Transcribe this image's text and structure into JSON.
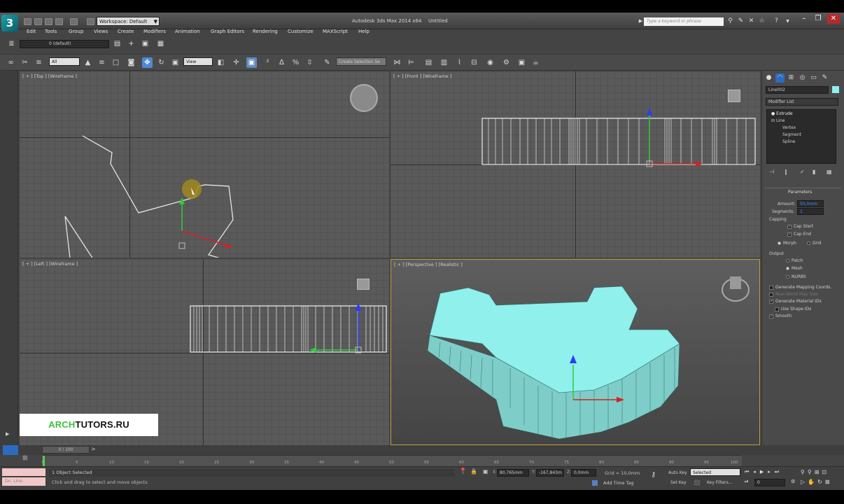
{
  "titlebar": {
    "workspace": "Workspace: Default",
    "app_title": "Autodesk 3ds Max 2014 x64",
    "doc_title": "Untitled",
    "search_placeholder": "Type a keyword or phrase"
  },
  "menu": [
    "Edit",
    "Tools",
    "Group",
    "Views",
    "Create",
    "Modifiers",
    "Animation",
    "Graph Editors",
    "Rendering",
    "Customize",
    "MAXScript",
    "Help"
  ],
  "layer_field": "0 (default)",
  "toolbar": {
    "selection_filter": "All",
    "ref_coord": "View",
    "named_selection": "Create Selection Se"
  },
  "viewports": {
    "top": "[ + ] [Top ] [Wireframe ]",
    "front": "[ + ] [Front ] [Wireframe ]",
    "left": "[ + ] [Left ] [Wireframe ]",
    "perspective": "[ + ] [Perspective ] [Realistic ]"
  },
  "command_panel": {
    "object_name": "Line002",
    "modifier_list": "Modifier List",
    "stack": [
      "Extrude",
      "Line",
      "Vertex",
      "Segment",
      "Spline"
    ],
    "rollout_title": "Parameters",
    "amount_label": "Amount:",
    "amount_value": "50,0mm",
    "segments_label": "Segments:",
    "segments_value": "1",
    "capping_label": "Capping",
    "cap_start": "Cap Start",
    "cap_end": "Cap End",
    "morph": "Morph",
    "grid": "Grid",
    "output_label": "Output",
    "patch": "Patch",
    "mesh": "Mesh",
    "nurbs": "NURBS",
    "gen_mapping": "Generate Mapping Coords.",
    "real_world": "Real-World Map Size",
    "gen_material": "Generate Material IDs",
    "use_shape": "Use Shape IDs",
    "smooth": "Smooth"
  },
  "timeline": {
    "frame_counter": "0 / 100",
    "ticks": [
      "0",
      "5",
      "10",
      "15",
      "20",
      "25",
      "30",
      "35",
      "40",
      "45",
      "50",
      "55",
      "60",
      "65",
      "70",
      "75",
      "80",
      "85",
      "90",
      "95",
      "100"
    ]
  },
  "status": {
    "selected": "1 Object Selected",
    "hint": "Click and drag to select and move objects",
    "x": "80,765mm",
    "y": "-167,843m",
    "z": "0,0mm",
    "grid": "Grid = 10,0mm",
    "auto_key": "Auto Key",
    "selected_dropdown": "Selected",
    "set_key": "Set Key",
    "key_filters": "Key Filters...",
    "add_time_tag": "Add Time Tag",
    "frame_field": "0",
    "maxscript_mini": "Dn. Line:"
  },
  "watermark": {
    "part1": "ARCH",
    "part2": "TUTORS.RU"
  },
  "colors": {
    "accent_blue": "#4d8ad6",
    "object_cyan": "#8ff0ec",
    "watermark_green": "#3fbf3f"
  }
}
